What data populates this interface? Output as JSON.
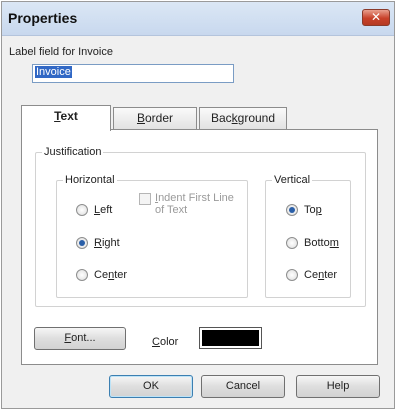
{
  "dialog": {
    "title": "Properties",
    "close_symbol": "✕"
  },
  "label_field": {
    "label": "Label field for Invoice",
    "value": "Invoice"
  },
  "tabs": [
    {
      "label": "Text",
      "underline": "T",
      "rest": "ext",
      "active": true
    },
    {
      "label": "Border",
      "underline": "B",
      "rest": "order",
      "active": false
    },
    {
      "label": "Background",
      "pre": "Bac",
      "underline": "k",
      "rest": "ground",
      "active": false
    }
  ],
  "justification": {
    "legend": "Justification",
    "horizontal": {
      "legend": "Horizontal",
      "left": {
        "underline": "L",
        "rest": "eft",
        "selected": false
      },
      "right": {
        "underline": "R",
        "rest": "ight",
        "selected": true
      },
      "center": {
        "pre": "Ce",
        "underline": "n",
        "rest": "ter",
        "selected": false
      },
      "indent_checkbox": {
        "line1_underline": "I",
        "line1_rest": "ndent First Line",
        "line2": "of Text",
        "checked": false,
        "enabled": false
      }
    },
    "vertical": {
      "legend": "Vertical",
      "top": {
        "pre": "To",
        "underline": "p",
        "rest": "",
        "selected": true
      },
      "bottom": {
        "pre": "Botto",
        "underline": "m",
        "rest": "",
        "selected": false
      },
      "center": {
        "pre": "Ce",
        "underline": "n",
        "rest": "ter",
        "selected": false
      }
    }
  },
  "font_button": {
    "underline": "F",
    "rest": "ont..."
  },
  "color": {
    "underline": "C",
    "rest": "olor",
    "value": "#000000"
  },
  "footer": {
    "ok": "OK",
    "cancel": "Cancel",
    "help": "Help"
  }
}
